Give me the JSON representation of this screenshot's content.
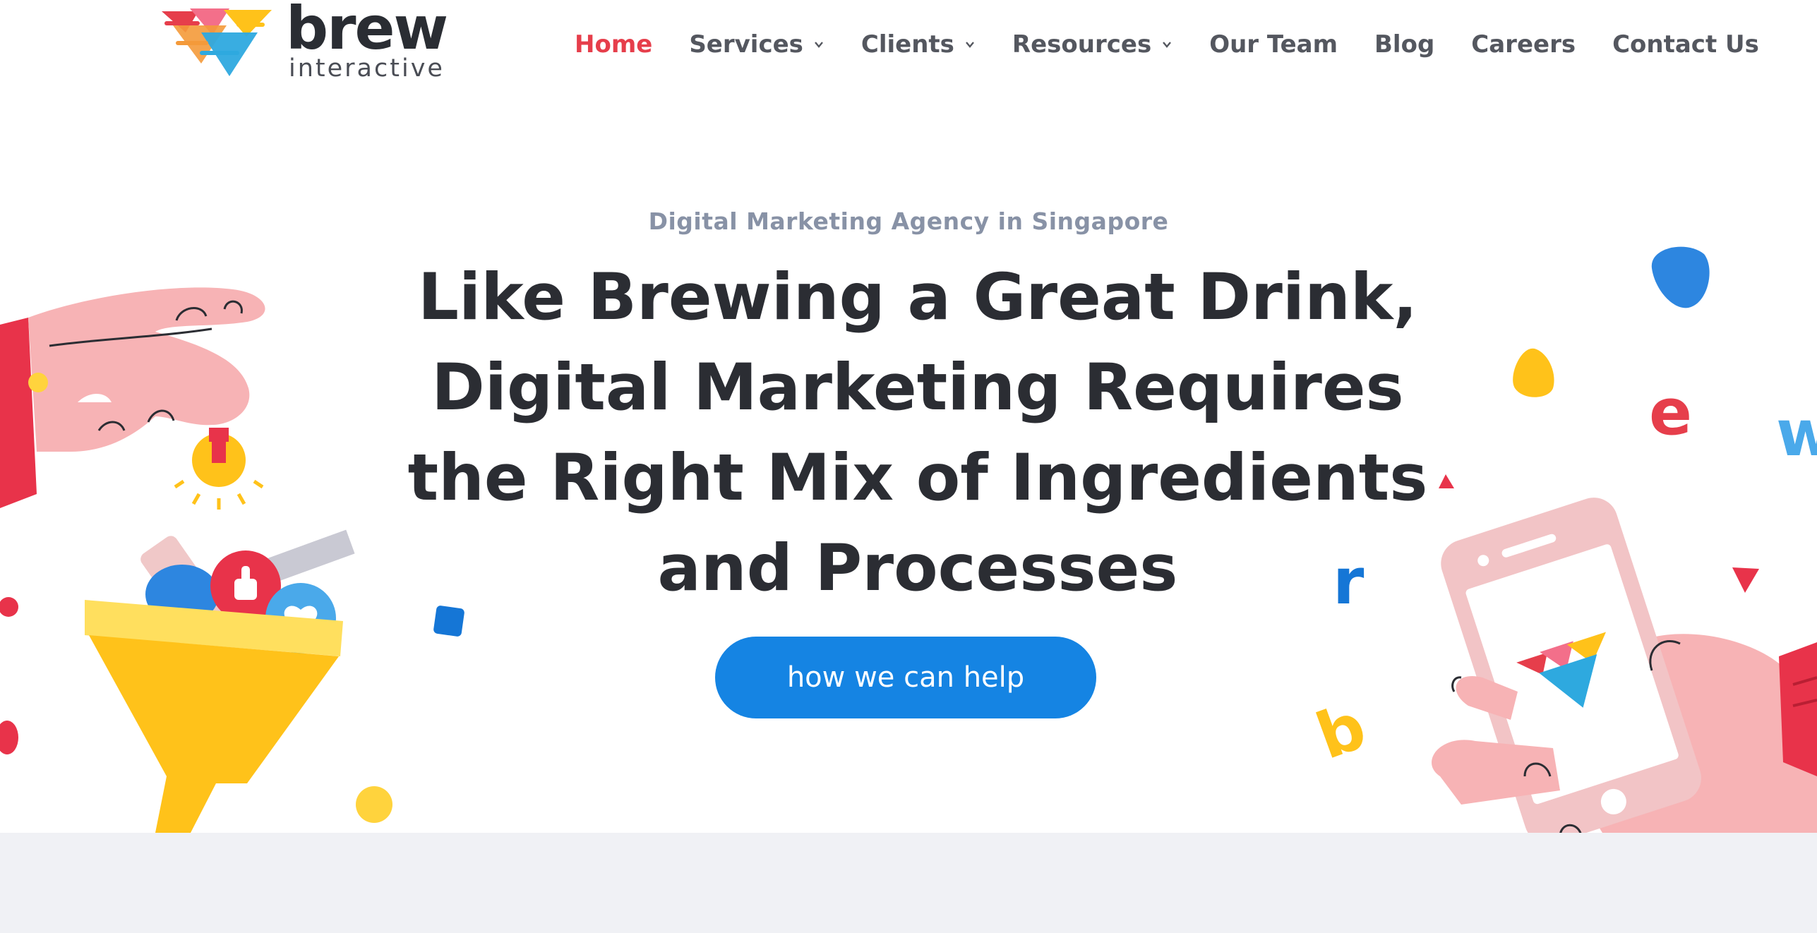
{
  "brand": {
    "name": "brew",
    "tagline": "interactive"
  },
  "nav": {
    "items": [
      {
        "label": "Home",
        "active": true,
        "dropdown": false
      },
      {
        "label": "Services",
        "active": false,
        "dropdown": true
      },
      {
        "label": "Clients",
        "active": false,
        "dropdown": true
      },
      {
        "label": "Resources",
        "active": false,
        "dropdown": true
      },
      {
        "label": "Our Team",
        "active": false,
        "dropdown": false
      },
      {
        "label": "Blog",
        "active": false,
        "dropdown": false
      },
      {
        "label": "Careers",
        "active": false,
        "dropdown": false
      },
      {
        "label": "Contact Us",
        "active": false,
        "dropdown": false
      }
    ]
  },
  "hero": {
    "kicker": "Digital Marketing Agency in Singapore",
    "headline": "Like Brewing a Great Drink, Digital Marketing Requires the Right Mix of Ingredients and Processes",
    "cta_label": "how we can help",
    "floating_letters": [
      "e",
      "w",
      "r",
      "b"
    ]
  },
  "colors": {
    "accent_red": "#e63e4b",
    "cta_blue": "#1584e3",
    "heading": "#2b2d33",
    "kicker": "#8892a6",
    "nav_text": "#54575f",
    "funnel_yellow": "#ffc21a",
    "skin_pink": "#f7b3b5",
    "footer_band": "#f0f1f5"
  },
  "icons": [
    "brew-logo-icon",
    "chevron-down-icon",
    "hand-illustration-icon",
    "funnel-illustration-icon",
    "lightbulb-icon",
    "thumbs-up-icon",
    "heart-icon",
    "phone-illustration-icon"
  ]
}
